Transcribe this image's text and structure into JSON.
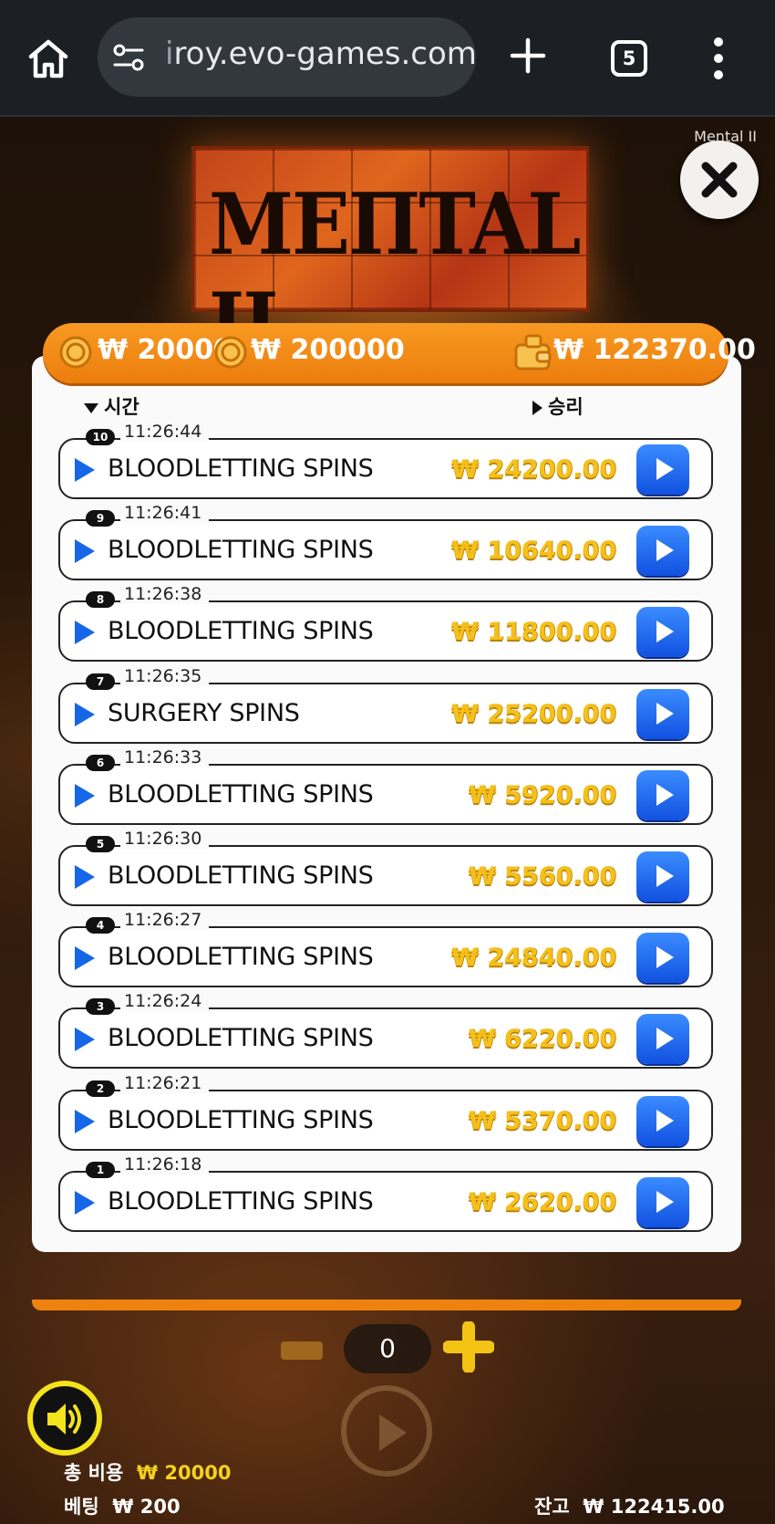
{
  "browser": {
    "url_dim": "i",
    "url": "roy.evo-games.com",
    "tab_count": "5"
  },
  "game": {
    "title": "Mental II",
    "logo_text": "MEΠTAL II"
  },
  "topbar": {
    "bet1": "₩ 20000",
    "bet2": "₩ 200000",
    "balance": "₩ 122370.00"
  },
  "headers": {
    "time": "시간",
    "win": "승리"
  },
  "rows": [
    {
      "idx": "10",
      "time": "11:26:44",
      "name": "BLOODLETTING SPINS",
      "amount": "₩ 24200.00"
    },
    {
      "idx": "9",
      "time": "11:26:41",
      "name": "BLOODLETTING SPINS",
      "amount": "₩ 10640.00"
    },
    {
      "idx": "8",
      "time": "11:26:38",
      "name": "BLOODLETTING SPINS",
      "amount": "₩ 11800.00"
    },
    {
      "idx": "7",
      "time": "11:26:35",
      "name": "SURGERY SPINS",
      "amount": "₩ 25200.00"
    },
    {
      "idx": "6",
      "time": "11:26:33",
      "name": "BLOODLETTING SPINS",
      "amount": "₩ 5920.00"
    },
    {
      "idx": "5",
      "time": "11:26:30",
      "name": "BLOODLETTING SPINS",
      "amount": "₩ 5560.00"
    },
    {
      "idx": "4",
      "time": "11:26:27",
      "name": "BLOODLETTING SPINS",
      "amount": "₩ 24840.00"
    },
    {
      "idx": "3",
      "time": "11:26:24",
      "name": "BLOODLETTING SPINS",
      "amount": "₩ 6220.00"
    },
    {
      "idx": "2",
      "time": "11:26:21",
      "name": "BLOODLETTING SPINS",
      "amount": "₩ 5370.00"
    },
    {
      "idx": "1",
      "time": "11:26:18",
      "name": "BLOODLETTING SPINS",
      "amount": "₩ 2620.00"
    }
  ],
  "controls": {
    "counter": "0"
  },
  "footer": {
    "total_label": "총 비용",
    "total_value": "₩ 20000",
    "bet_label": "베팅",
    "bet_value": "₩ 200",
    "balance_label": "잔고",
    "balance_value": "₩ 122415.00"
  },
  "colors": {
    "accent_orange": "#ee820f",
    "play_blue": "#1667e8",
    "win_gold": "#f5c01b"
  }
}
